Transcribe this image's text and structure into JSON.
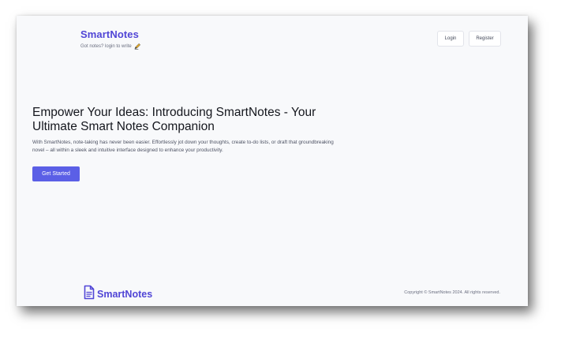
{
  "header": {
    "brand": "SmartNotes",
    "tagline": "Got notes? login to write",
    "tagline_icon": "pencil-icon",
    "nav": {
      "login_label": "Login",
      "register_label": "Register"
    }
  },
  "hero": {
    "title": "Empower Your Ideas: Introducing SmartNotes - Your Ultimate Smart Notes Companion",
    "description": "With SmartNotes, note-taking has never been easier. Effortlessly jot down your thoughts, create to-do lists, or draft that groundbreaking novel – all within a sleek and intuitive interface designed to enhance your productivity.",
    "cta_label": "Get Started"
  },
  "footer": {
    "brand": "SmartNotes",
    "brand_icon": "document-icon",
    "copyright": "Copyright © SmartNotes 2024. All rights reserved."
  },
  "colors": {
    "brand": "#5146d6",
    "accent": "#5b5fe6",
    "background": "#f8f9fb"
  }
}
